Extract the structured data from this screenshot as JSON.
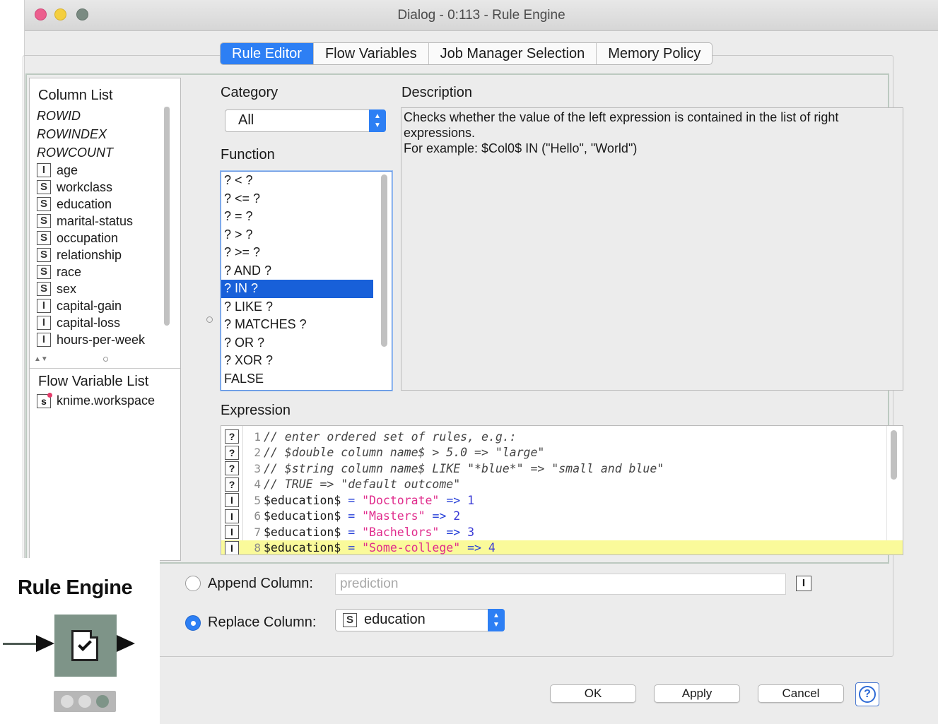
{
  "window": {
    "title": "Dialog - 0:113 - Rule Engine"
  },
  "tabs": [
    {
      "label": "Rule Editor",
      "active": true
    },
    {
      "label": "Flow Variables",
      "active": false
    },
    {
      "label": "Job Manager Selection",
      "active": false
    },
    {
      "label": "Memory Policy",
      "active": false
    }
  ],
  "column_list": {
    "title": "Column List",
    "special_items": [
      "ROWID",
      "ROWINDEX",
      "ROWCOUNT"
    ],
    "columns": [
      {
        "type": "I",
        "name": "age"
      },
      {
        "type": "S",
        "name": "workclass"
      },
      {
        "type": "S",
        "name": "education"
      },
      {
        "type": "S",
        "name": "marital-status"
      },
      {
        "type": "S",
        "name": "occupation"
      },
      {
        "type": "S",
        "name": "relationship"
      },
      {
        "type": "S",
        "name": "race"
      },
      {
        "type": "S",
        "name": "sex"
      },
      {
        "type": "I",
        "name": "capital-gain"
      },
      {
        "type": "I",
        "name": "capital-loss"
      },
      {
        "type": "I",
        "name": "hours-per-week"
      }
    ]
  },
  "flow_variable_list": {
    "title": "Flow Variable List",
    "items": [
      {
        "type": "s",
        "name": "knime.workspace"
      }
    ]
  },
  "category": {
    "label": "Category",
    "selected": "All"
  },
  "function": {
    "label": "Function",
    "items": [
      "? < ?",
      "? <= ?",
      "? = ?",
      "? > ?",
      "? >= ?",
      "? AND ?",
      "? IN ?",
      "? LIKE ?",
      "? MATCHES ?",
      "? OR ?",
      "? XOR ?",
      "FALSE"
    ],
    "selected_index": 6
  },
  "description": {
    "label": "Description",
    "line1": "Checks whether the value of the left expression is contained in the list of right",
    "line2": "expressions.",
    "line3": "For example: $Col0$ IN (\"Hello\", \"World\")"
  },
  "expression": {
    "label": "Expression",
    "lines": [
      {
        "no": "1",
        "icon": "?",
        "comment": "// enter ordered set of rules, e.g.:"
      },
      {
        "no": "2",
        "icon": "?",
        "comment": "// $double column name$ > 5.0 => \"large\""
      },
      {
        "no": "3",
        "icon": "?",
        "comment": "// $string column name$ LIKE \"*blue*\" => \"small and blue\""
      },
      {
        "no": "4",
        "icon": "?",
        "comment": "// TRUE => \"default outcome\""
      },
      {
        "no": "5",
        "icon": "I",
        "var": "$education$",
        "op": "=",
        "str": "\"Doctorate\"",
        "arrow": "=>",
        "num": "1"
      },
      {
        "no": "6",
        "icon": "I",
        "var": "$education$",
        "op": "=",
        "str": "\"Masters\"",
        "arrow": "=>",
        "num": "2"
      },
      {
        "no": "7",
        "icon": "I",
        "var": "$education$",
        "op": "=",
        "str": "\"Bachelors\"",
        "arrow": "=>",
        "num": "3"
      },
      {
        "no": "8",
        "icon": "I",
        "var": "$education$",
        "op": "=",
        "str": "\"Some-college\"",
        "arrow": "=>",
        "num": "4",
        "highlight": true
      }
    ]
  },
  "append_column": {
    "label": "Append Column:",
    "placeholder": "prediction",
    "type_badge": "I",
    "selected": false
  },
  "replace_column": {
    "label": "Replace Column:",
    "type_badge": "S",
    "value": "education",
    "selected": true
  },
  "buttons": {
    "ok": "OK",
    "apply": "Apply",
    "cancel": "Cancel",
    "help": "?"
  },
  "node": {
    "title": "Rule Engine",
    "status_lights": [
      "off",
      "off",
      "green"
    ]
  },
  "colors": {
    "accent": "#2d7ff4",
    "selection": "#1860d9",
    "string_literal": "#e02b8c",
    "operator": "#2740d8",
    "highlight_line": "#fafa9a",
    "node_body": "#7e9488"
  }
}
